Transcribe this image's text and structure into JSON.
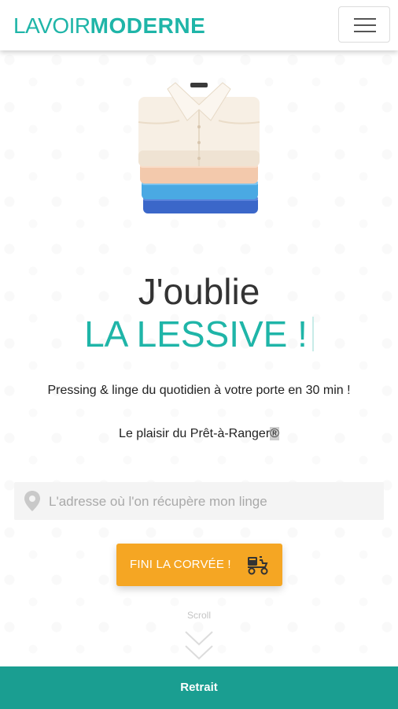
{
  "header": {
    "logo_light": "LAVOIR",
    "logo_bold": "MODERNE",
    "menu_icon": "hamburger-menu-icon"
  },
  "hero": {
    "illustration": "folded-shirts-stack",
    "headline_line1": "J'oublie",
    "headline_line2": "LA LESSIVE !",
    "tagline": "Pressing & linge du quotidien à votre porte en 30 min !",
    "subtagline_prefix": "Le plaisir du Prêt-à-Ranger",
    "subtagline_mark": "®"
  },
  "address": {
    "icon": "location-pin-icon",
    "placeholder": "L'adresse où l'on récupère mon linge",
    "value": ""
  },
  "cta": {
    "label": "FINI LA CORVÉE !",
    "icon": "delivery-scooter-icon"
  },
  "scroll": {
    "label": "Scroll",
    "icon": "double-chevron-down-icon"
  },
  "bottom_bar": {
    "label": "Retrait"
  },
  "colors": {
    "brand_teal": "#1fb5a8",
    "bottom_bar_teal": "#1a9e91",
    "cta_orange": "#f5a623",
    "headline_dark": "#333333"
  }
}
